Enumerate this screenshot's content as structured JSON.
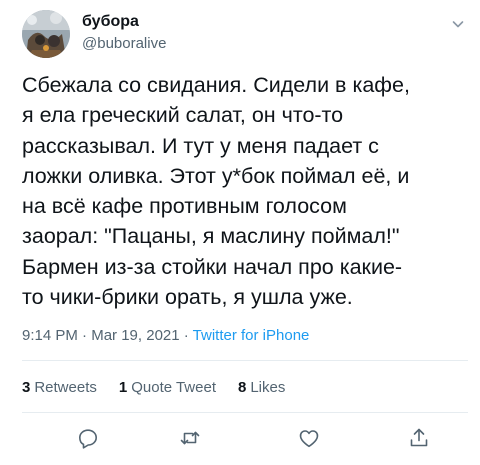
{
  "author": {
    "display_name": "бубора",
    "handle": "@buboralive",
    "avatar_icon": "avatar-image"
  },
  "tweet": {
    "text": "Сбежала со свидания. Сидели в кафе,\nя ела греческий салат, он что-то\nрассказывал. И тут у меня падает с\nложки оливка. Этот у*бок поймал её, и\nна всё кафе противным голосом\nзаорал: \"Пацаны, я маслину поймал!\"\nБармен из-за стойки начал про какие-\nто чики-брики орать, я ушла уже."
  },
  "meta": {
    "time": "9:14 PM",
    "separator1": " · ",
    "date": "Mar 19, 2021",
    "separator2": " · ",
    "source": "Twitter for iPhone"
  },
  "stats": {
    "retweets_count": "3",
    "retweets_label": "Retweets",
    "quotes_count": "1",
    "quotes_label": "Quote Tweet",
    "likes_count": "8",
    "likes_label": "Likes"
  },
  "actions": {
    "reply": "reply-icon",
    "retweet": "retweet-icon",
    "like": "heart-icon",
    "share": "share-icon"
  },
  "colors": {
    "text": "#0f1419",
    "secondary": "#536471",
    "link": "#1d9bf0",
    "divider": "#e6ecf0"
  }
}
